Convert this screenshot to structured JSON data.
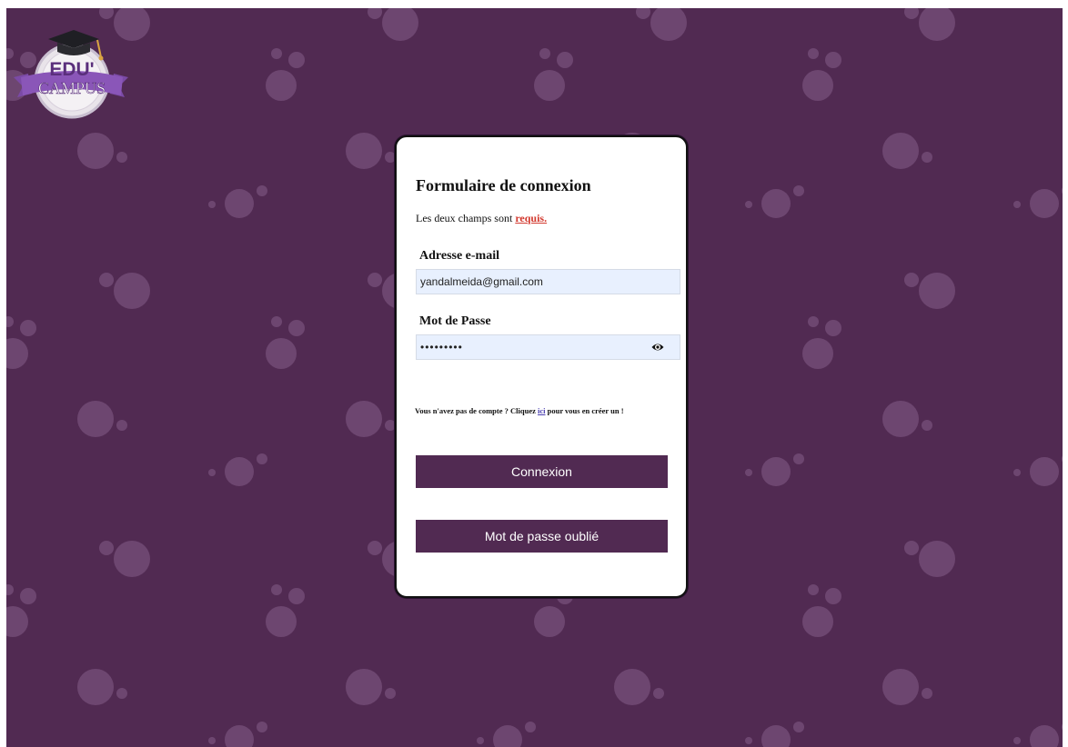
{
  "logo": {
    "line1": "EDU'",
    "line2": "CAMPUS"
  },
  "form": {
    "title": "Formulaire de connexion",
    "required_prefix": "Les deux champs sont ",
    "required_link": "requis.",
    "email_label": "Adresse e-mail",
    "email_value": "yandalmeida@gmail.com",
    "password_label": "Mot de Passe",
    "password_value": "•••••••••",
    "signup_prefix": "Vous n'avez pas de compte ? Cliquez ",
    "signup_link": "ici",
    "signup_suffix": " pour vous en créer un !",
    "login_button": "Connexion",
    "forgot_button": "Mot de passe oublié"
  },
  "colors": {
    "background": "#512a52",
    "bubble": "#6d4670",
    "button": "#512a52",
    "field_fill": "#e8f0fe",
    "required_link": "#d33a2f",
    "signup_link": "#4a3fb0"
  },
  "icons": {
    "password_toggle": "eye-icon",
    "logo_hat": "graduation-cap-icon"
  }
}
